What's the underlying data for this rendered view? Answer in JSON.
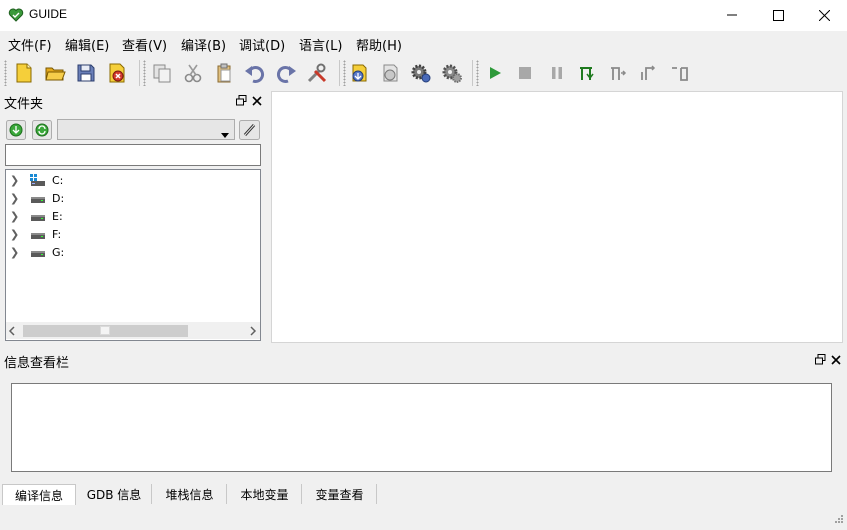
{
  "window": {
    "title": "GUIDE"
  },
  "menu": [
    {
      "label": "文件(F)"
    },
    {
      "label": "编辑(E)"
    },
    {
      "label": "查看(V)"
    },
    {
      "label": "编译(B)"
    },
    {
      "label": "调试(D)"
    },
    {
      "label": "语言(L)"
    },
    {
      "label": "帮助(H)"
    }
  ],
  "toolbar": {
    "icons": [
      "new-file-icon",
      "open-folder-icon",
      "save-icon",
      "close-file-icon",
      "copy-icon",
      "cut-icon",
      "paste-icon",
      "undo-icon",
      "redo-icon",
      "tools-icon",
      "compile-icon",
      "build-icon",
      "settings-gear-icon",
      "settings-gear-2-icon",
      "run-icon",
      "stop-icon",
      "pause-icon",
      "step-into-icon",
      "step-over-icon",
      "step-out-icon",
      "run-to-cursor-icon"
    ]
  },
  "folder_panel": {
    "title": "文件夹",
    "path_value": "",
    "drives": [
      {
        "label": "C:"
      },
      {
        "label": "D:"
      },
      {
        "label": "E:"
      },
      {
        "label": "F:"
      },
      {
        "label": "G:"
      }
    ]
  },
  "info_panel": {
    "title": "信息查看栏",
    "tabs": [
      {
        "label": "编译信息"
      },
      {
        "label": "GDB 信息"
      },
      {
        "label": "堆栈信息"
      },
      {
        "label": "本地变量"
      },
      {
        "label": "变量查看"
      }
    ]
  },
  "colors": {
    "run": "#2e8b2e",
    "disabled": "#9a9a9a",
    "debug_green": "#1f7a1f",
    "icon_gold": "#e8b400"
  }
}
